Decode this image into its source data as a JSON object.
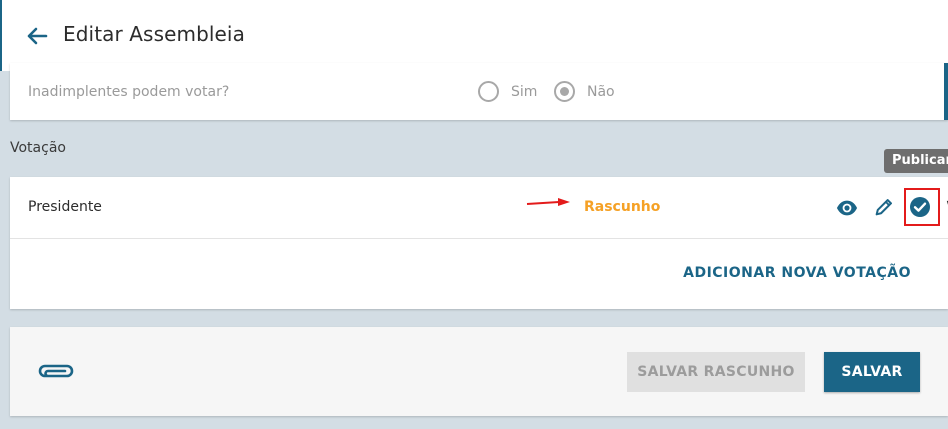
{
  "header": {
    "title": "Editar Assembleia",
    "back_icon": "arrow-left-icon"
  },
  "question": {
    "label": "Inadimplentes podem votar?",
    "options": [
      {
        "label": "Sim",
        "selected": false
      },
      {
        "label": "Não",
        "selected": true
      }
    ]
  },
  "voting": {
    "section_title": "Votação",
    "tooltip": "Publicar",
    "items": [
      {
        "name": "Presidente",
        "status": "Rascunho",
        "status_color": "#f5a126",
        "actions": [
          "eye-icon",
          "pencil-icon",
          "check-circle-icon"
        ]
      }
    ],
    "add_label": "ADICIONAR NOVA VOTAÇÃO"
  },
  "footer": {
    "attach_icon": "paperclip-icon",
    "draft_label": "SALVAR RASCUNHO",
    "save_label": "SALVAR"
  },
  "colors": {
    "primary": "#1b6587",
    "draft_status": "#f5a126",
    "annotation": "#e31b1b",
    "page_bg": "#d3dde4"
  }
}
